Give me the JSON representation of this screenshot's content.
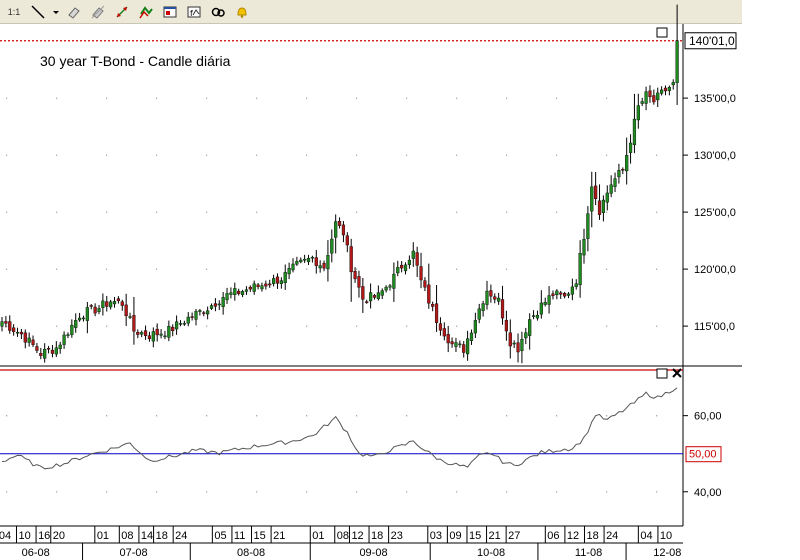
{
  "toolbar": {
    "items": [
      "cursor-mode",
      "line-tool",
      "menu-arrow",
      "eraser-tool",
      "clear-drawings-tool",
      "fibonacci-tool",
      "templates-tool",
      "indicator-tool",
      "link-tool",
      "alert-bell-tool"
    ],
    "zoom_label": "1:1"
  },
  "chart_data": [
    {
      "type": "candlestick",
      "title": "30 year T-Bond - Candle diária",
      "y_range": [
        111.5,
        141.5
      ],
      "y_ticks": [
        115,
        120,
        125,
        130,
        135
      ],
      "y_tick_labels": [
        "115'00,0",
        "120'00,0",
        "125'00,0",
        "130'00,0",
        "135'00,0"
      ],
      "last_price_label": "140'01,0",
      "last_price": 140.03,
      "grid": true,
      "colors": {
        "up": "#1f8a1f",
        "down": "#b01818",
        "wick": "#000000",
        "last_line": "#cc0000"
      },
      "anchors": [
        {
          "bar": 0,
          "close": 115.4
        },
        {
          "bar": 5,
          "close": 114.3
        },
        {
          "bar": 10,
          "close": 112.6
        },
        {
          "bar": 14,
          "close": 113.1
        },
        {
          "bar": 20,
          "close": 116.0
        },
        {
          "bar": 25,
          "close": 116.6
        },
        {
          "bar": 28,
          "close": 117.2
        },
        {
          "bar": 31,
          "close": 117.0
        },
        {
          "bar": 34,
          "close": 114.6
        },
        {
          "bar": 38,
          "close": 114.2
        },
        {
          "bar": 43,
          "close": 114.6
        },
        {
          "bar": 48,
          "close": 115.7
        },
        {
          "bar": 53,
          "close": 116.6
        },
        {
          "bar": 57,
          "close": 117.6
        },
        {
          "bar": 62,
          "close": 118.1
        },
        {
          "bar": 67,
          "close": 118.6
        },
        {
          "bar": 72,
          "close": 119.2
        },
        {
          "bar": 76,
          "close": 120.3
        },
        {
          "bar": 80,
          "close": 121.0
        },
        {
          "bar": 83,
          "close": 120.2
        },
        {
          "bar": 86,
          "close": 124.0
        },
        {
          "bar": 88,
          "close": 123.2
        },
        {
          "bar": 90,
          "close": 120.2
        },
        {
          "bar": 93,
          "close": 117.4
        },
        {
          "bar": 97,
          "close": 117.6
        },
        {
          "bar": 101,
          "close": 119.3
        },
        {
          "bar": 104,
          "close": 120.8
        },
        {
          "bar": 106,
          "close": 121.4
        },
        {
          "bar": 108,
          "close": 118.9
        },
        {
          "bar": 112,
          "close": 115.6
        },
        {
          "bar": 116,
          "close": 113.4
        },
        {
          "bar": 119,
          "close": 113.0
        },
        {
          "bar": 122,
          "close": 115.7
        },
        {
          "bar": 125,
          "close": 118.2
        },
        {
          "bar": 128,
          "close": 117.2
        },
        {
          "bar": 131,
          "close": 113.7
        },
        {
          "bar": 133,
          "close": 113.1
        },
        {
          "bar": 136,
          "close": 115.6
        },
        {
          "bar": 139,
          "close": 116.8
        },
        {
          "bar": 142,
          "close": 117.8
        },
        {
          "bar": 145,
          "close": 117.5
        },
        {
          "bar": 148,
          "close": 119.1
        },
        {
          "bar": 150,
          "close": 123.0
        },
        {
          "bar": 152,
          "close": 127.5
        },
        {
          "bar": 154,
          "close": 125.2
        },
        {
          "bar": 157,
          "close": 127.5
        },
        {
          "bar": 160,
          "close": 128.7
        },
        {
          "bar": 162,
          "close": 131.4
        },
        {
          "bar": 164,
          "close": 134.2
        },
        {
          "bar": 166,
          "close": 135.2
        },
        {
          "bar": 168,
          "close": 134.7
        },
        {
          "bar": 171,
          "close": 135.7
        },
        {
          "bar": 173,
          "close": 136.2
        },
        {
          "bar": 174,
          "close": 140.03
        }
      ]
    },
    {
      "type": "line",
      "name": "oscillator",
      "y_range": [
        31,
        72
      ],
      "y_ticks": [
        40,
        60
      ],
      "y_tick_labels": [
        "40,00",
        "60,00"
      ],
      "reference_line": 50,
      "reference_label": "50,00",
      "colors": {
        "line": "#555555",
        "reference": "#0000cc",
        "reference_label": "#cc0000"
      },
      "anchors": [
        {
          "bar": 0,
          "value": 48.0
        },
        {
          "bar": 4,
          "value": 49.6
        },
        {
          "bar": 10,
          "value": 46.2
        },
        {
          "bar": 16,
          "value": 47.4
        },
        {
          "bar": 22,
          "value": 49.6
        },
        {
          "bar": 28,
          "value": 51.2
        },
        {
          "bar": 33,
          "value": 52.8
        },
        {
          "bar": 38,
          "value": 48.2
        },
        {
          "bar": 44,
          "value": 49.3
        },
        {
          "bar": 50,
          "value": 50.9
        },
        {
          "bar": 56,
          "value": 50.2
        },
        {
          "bar": 62,
          "value": 51.4
        },
        {
          "bar": 68,
          "value": 52.4
        },
        {
          "bar": 74,
          "value": 53.1
        },
        {
          "bar": 80,
          "value": 54.7
        },
        {
          "bar": 86,
          "value": 59.4
        },
        {
          "bar": 89,
          "value": 55.6
        },
        {
          "bar": 92,
          "value": 50.0
        },
        {
          "bar": 96,
          "value": 49.2
        },
        {
          "bar": 100,
          "value": 51.0
        },
        {
          "bar": 104,
          "value": 52.4
        },
        {
          "bar": 106,
          "value": 53.4
        },
        {
          "bar": 109,
          "value": 50.9
        },
        {
          "bar": 113,
          "value": 48.3
        },
        {
          "bar": 117,
          "value": 47.1
        },
        {
          "bar": 120,
          "value": 46.4
        },
        {
          "bar": 123,
          "value": 49.4
        },
        {
          "bar": 126,
          "value": 50.2
        },
        {
          "bar": 129,
          "value": 48.0
        },
        {
          "bar": 132,
          "value": 46.8
        },
        {
          "bar": 135,
          "value": 48.4
        },
        {
          "bar": 139,
          "value": 50.3
        },
        {
          "bar": 143,
          "value": 51.0
        },
        {
          "bar": 147,
          "value": 51.4
        },
        {
          "bar": 150,
          "value": 54.0
        },
        {
          "bar": 153,
          "value": 60.3
        },
        {
          "bar": 156,
          "value": 58.8
        },
        {
          "bar": 160,
          "value": 61.3
        },
        {
          "bar": 163,
          "value": 63.4
        },
        {
          "bar": 166,
          "value": 65.8
        },
        {
          "bar": 169,
          "value": 64.7
        },
        {
          "bar": 172,
          "value": 66.4
        },
        {
          "bar": 174,
          "value": 67.7
        }
      ]
    }
  ],
  "x_axis": {
    "days": [
      {
        "label": "04",
        "bar": 1
      },
      {
        "label": "10",
        "bar": 5
      },
      {
        "label": "16",
        "bar": 9
      },
      {
        "label": "20",
        "bar": 12
      },
      {
        "label": "01",
        "bar": 21
      },
      {
        "label": "08",
        "bar": 26
      },
      {
        "label": "14",
        "bar": 30
      },
      {
        "label": "18",
        "bar": 33
      },
      {
        "label": "24",
        "bar": 37
      },
      {
        "label": "05",
        "bar": 45
      },
      {
        "label": "11",
        "bar": 49
      },
      {
        "label": "15",
        "bar": 53
      },
      {
        "label": "21",
        "bar": 57
      },
      {
        "label": "01",
        "bar": 65
      },
      {
        "label": "08",
        "bar": 70
      },
      {
        "label": "12",
        "bar": 73
      },
      {
        "label": "18",
        "bar": 77
      },
      {
        "label": "23",
        "bar": 81
      },
      {
        "label": "03",
        "bar": 89
      },
      {
        "label": "09",
        "bar": 93
      },
      {
        "label": "15",
        "bar": 97
      },
      {
        "label": "21",
        "bar": 101
      },
      {
        "label": "27",
        "bar": 105
      },
      {
        "label": "06",
        "bar": 113
      },
      {
        "label": "12",
        "bar": 117
      },
      {
        "label": "18",
        "bar": 121
      },
      {
        "label": "24",
        "bar": 125
      },
      {
        "label": "04",
        "bar": 132
      },
      {
        "label": "10",
        "bar": 136
      }
    ],
    "months": [
      {
        "label": "06-08",
        "bar": 4
      },
      {
        "label": "07-08",
        "bar": 24
      },
      {
        "label": "08-08",
        "bar": 48
      },
      {
        "label": "09-08",
        "bar": 73
      },
      {
        "label": "10-08",
        "bar": 97
      },
      {
        "label": "11-08",
        "bar": 117
      },
      {
        "label": "12-08",
        "bar": 133
      }
    ]
  }
}
